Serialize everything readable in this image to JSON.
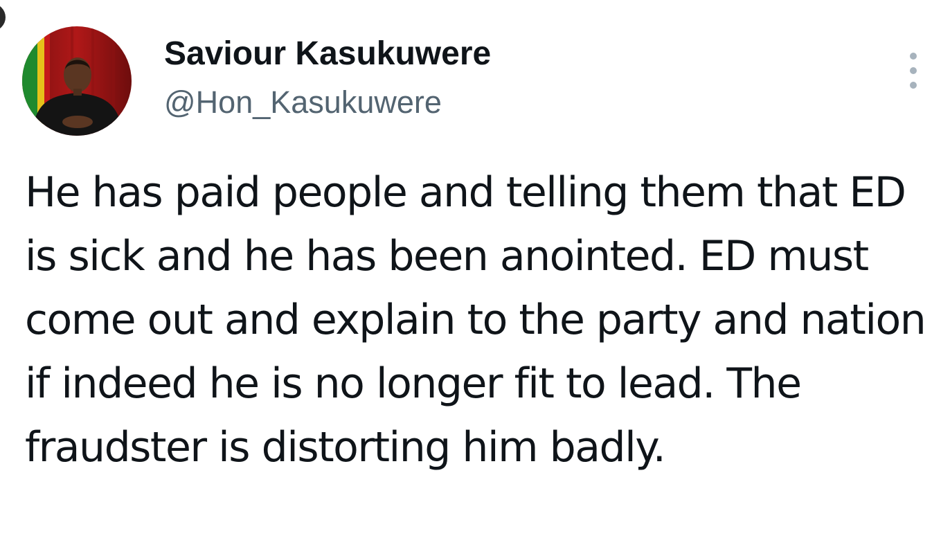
{
  "author": {
    "display_name": "Saviour Kasukuwere",
    "handle": "@Hon_Kasukuwere"
  },
  "tweet": {
    "text": "He has paid people and telling them that ED is sick and he has been anointed. ED must come out and explain to the party and nation if indeed he is no longer fit to lead. The fraudster is distorting him badly."
  },
  "icons": {
    "more": "more-vertical-icon"
  },
  "colors": {
    "text_primary": "#0f1419",
    "text_secondary": "#536471",
    "more_icon": "#a7b3bd"
  }
}
